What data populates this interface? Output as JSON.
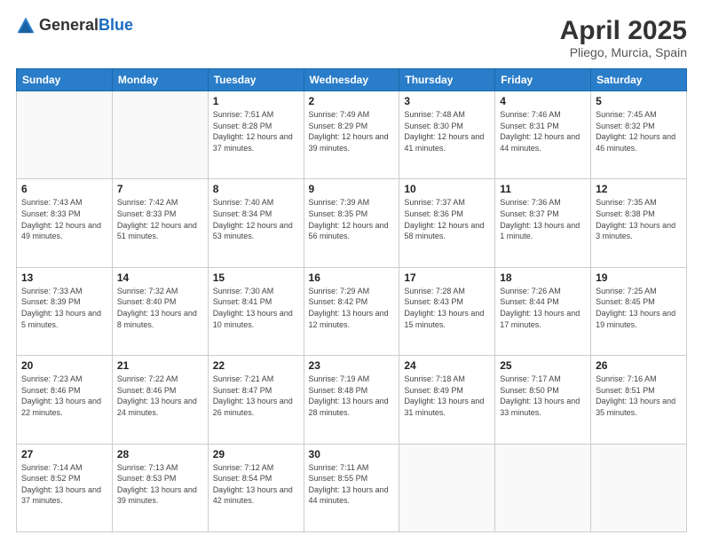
{
  "logo": {
    "general": "General",
    "blue": "Blue"
  },
  "title": {
    "month": "April 2025",
    "location": "Pliego, Murcia, Spain"
  },
  "weekdays": [
    "Sunday",
    "Monday",
    "Tuesday",
    "Wednesday",
    "Thursday",
    "Friday",
    "Saturday"
  ],
  "weeks": [
    [
      {
        "day": "",
        "detail": ""
      },
      {
        "day": "",
        "detail": ""
      },
      {
        "day": "1",
        "detail": "Sunrise: 7:51 AM\nSunset: 8:28 PM\nDaylight: 12 hours and 37 minutes."
      },
      {
        "day": "2",
        "detail": "Sunrise: 7:49 AM\nSunset: 8:29 PM\nDaylight: 12 hours and 39 minutes."
      },
      {
        "day": "3",
        "detail": "Sunrise: 7:48 AM\nSunset: 8:30 PM\nDaylight: 12 hours and 41 minutes."
      },
      {
        "day": "4",
        "detail": "Sunrise: 7:46 AM\nSunset: 8:31 PM\nDaylight: 12 hours and 44 minutes."
      },
      {
        "day": "5",
        "detail": "Sunrise: 7:45 AM\nSunset: 8:32 PM\nDaylight: 12 hours and 46 minutes."
      }
    ],
    [
      {
        "day": "6",
        "detail": "Sunrise: 7:43 AM\nSunset: 8:33 PM\nDaylight: 12 hours and 49 minutes."
      },
      {
        "day": "7",
        "detail": "Sunrise: 7:42 AM\nSunset: 8:33 PM\nDaylight: 12 hours and 51 minutes."
      },
      {
        "day": "8",
        "detail": "Sunrise: 7:40 AM\nSunset: 8:34 PM\nDaylight: 12 hours and 53 minutes."
      },
      {
        "day": "9",
        "detail": "Sunrise: 7:39 AM\nSunset: 8:35 PM\nDaylight: 12 hours and 56 minutes."
      },
      {
        "day": "10",
        "detail": "Sunrise: 7:37 AM\nSunset: 8:36 PM\nDaylight: 12 hours and 58 minutes."
      },
      {
        "day": "11",
        "detail": "Sunrise: 7:36 AM\nSunset: 8:37 PM\nDaylight: 13 hours and 1 minute."
      },
      {
        "day": "12",
        "detail": "Sunrise: 7:35 AM\nSunset: 8:38 PM\nDaylight: 13 hours and 3 minutes."
      }
    ],
    [
      {
        "day": "13",
        "detail": "Sunrise: 7:33 AM\nSunset: 8:39 PM\nDaylight: 13 hours and 5 minutes."
      },
      {
        "day": "14",
        "detail": "Sunrise: 7:32 AM\nSunset: 8:40 PM\nDaylight: 13 hours and 8 minutes."
      },
      {
        "day": "15",
        "detail": "Sunrise: 7:30 AM\nSunset: 8:41 PM\nDaylight: 13 hours and 10 minutes."
      },
      {
        "day": "16",
        "detail": "Sunrise: 7:29 AM\nSunset: 8:42 PM\nDaylight: 13 hours and 12 minutes."
      },
      {
        "day": "17",
        "detail": "Sunrise: 7:28 AM\nSunset: 8:43 PM\nDaylight: 13 hours and 15 minutes."
      },
      {
        "day": "18",
        "detail": "Sunrise: 7:26 AM\nSunset: 8:44 PM\nDaylight: 13 hours and 17 minutes."
      },
      {
        "day": "19",
        "detail": "Sunrise: 7:25 AM\nSunset: 8:45 PM\nDaylight: 13 hours and 19 minutes."
      }
    ],
    [
      {
        "day": "20",
        "detail": "Sunrise: 7:23 AM\nSunset: 8:46 PM\nDaylight: 13 hours and 22 minutes."
      },
      {
        "day": "21",
        "detail": "Sunrise: 7:22 AM\nSunset: 8:46 PM\nDaylight: 13 hours and 24 minutes."
      },
      {
        "day": "22",
        "detail": "Sunrise: 7:21 AM\nSunset: 8:47 PM\nDaylight: 13 hours and 26 minutes."
      },
      {
        "day": "23",
        "detail": "Sunrise: 7:19 AM\nSunset: 8:48 PM\nDaylight: 13 hours and 28 minutes."
      },
      {
        "day": "24",
        "detail": "Sunrise: 7:18 AM\nSunset: 8:49 PM\nDaylight: 13 hours and 31 minutes."
      },
      {
        "day": "25",
        "detail": "Sunrise: 7:17 AM\nSunset: 8:50 PM\nDaylight: 13 hours and 33 minutes."
      },
      {
        "day": "26",
        "detail": "Sunrise: 7:16 AM\nSunset: 8:51 PM\nDaylight: 13 hours and 35 minutes."
      }
    ],
    [
      {
        "day": "27",
        "detail": "Sunrise: 7:14 AM\nSunset: 8:52 PM\nDaylight: 13 hours and 37 minutes."
      },
      {
        "day": "28",
        "detail": "Sunrise: 7:13 AM\nSunset: 8:53 PM\nDaylight: 13 hours and 39 minutes."
      },
      {
        "day": "29",
        "detail": "Sunrise: 7:12 AM\nSunset: 8:54 PM\nDaylight: 13 hours and 42 minutes."
      },
      {
        "day": "30",
        "detail": "Sunrise: 7:11 AM\nSunset: 8:55 PM\nDaylight: 13 hours and 44 minutes."
      },
      {
        "day": "",
        "detail": ""
      },
      {
        "day": "",
        "detail": ""
      },
      {
        "day": "",
        "detail": ""
      }
    ]
  ]
}
